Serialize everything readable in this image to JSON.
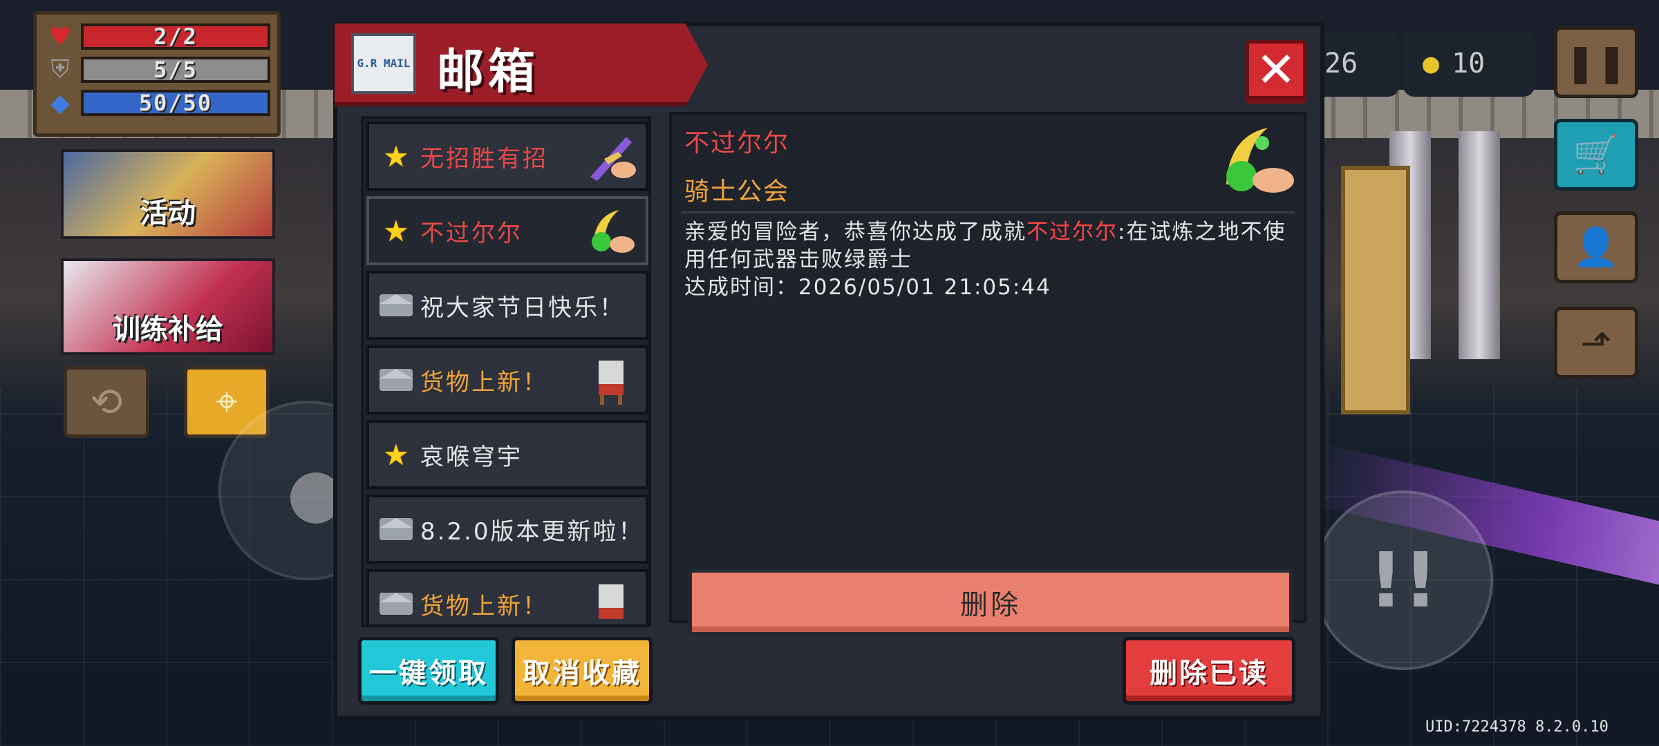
{
  "hud": {
    "hp": {
      "text": "2/2",
      "fill": 1.0,
      "color": "#c8262c",
      "icon": "heart-icon"
    },
    "armor": {
      "text": "5/5",
      "fill": 1.0,
      "color": "#8c8c8c",
      "icon": "shield-icon"
    },
    "energy": {
      "text": "50/50",
      "fill": 1.0,
      "color": "#3567c9",
      "icon": "energy-icon"
    },
    "gems": "26",
    "coins": "10",
    "uid": "UID:7224378 8.2.0.10"
  },
  "left_tiles": {
    "activity": "活动",
    "training": "训练补给"
  },
  "mailbox": {
    "title": "邮箱",
    "envelope_text": "G.R MAIL",
    "mails": [
      {
        "title": "无招胜有招",
        "icon": "star-icon",
        "title_color": "#e94848",
        "attachment": "sword-hand-icon"
      },
      {
        "title": "不过尔尔",
        "icon": "star-icon",
        "title_color": "#e94848",
        "attachment": "green-slash-hand-icon"
      },
      {
        "title": "祝大家节日快乐！",
        "icon": "envelope-icon",
        "title_color": "#e6e6e6",
        "attachment": ""
      },
      {
        "title": "货物上新！",
        "icon": "envelope-icon",
        "title_color": "#f2a43a",
        "attachment": "cat-merchant-icon"
      },
      {
        "title": "哀喉穹宇",
        "icon": "star-icon",
        "title_color": "#e6e6e6",
        "attachment": ""
      },
      {
        "title": "8.2.0版本更新啦！",
        "icon": "envelope-icon",
        "title_color": "#e6e6e6",
        "attachment": ""
      },
      {
        "title": "货物上新！",
        "icon": "envelope-icon",
        "title_color": "#f2a43a",
        "attachment": "cat-merchant-icon"
      }
    ],
    "detail": {
      "sender_title": "不过尔尔",
      "from": "骑士公会",
      "body_prefix": "亲爱的冒险者，恭喜你达成了成就",
      "body_highlight": "不过尔尔",
      "body_suffix": ":在试炼之地不使用任何武器击败绿爵士",
      "achieved_line": "达成时间：2026/05/01 21:05:44",
      "delete_label": "删除"
    },
    "buttons": {
      "claim_all": "一键领取",
      "unfavorite": "取消收藏",
      "delete_read": "删除已读"
    }
  }
}
